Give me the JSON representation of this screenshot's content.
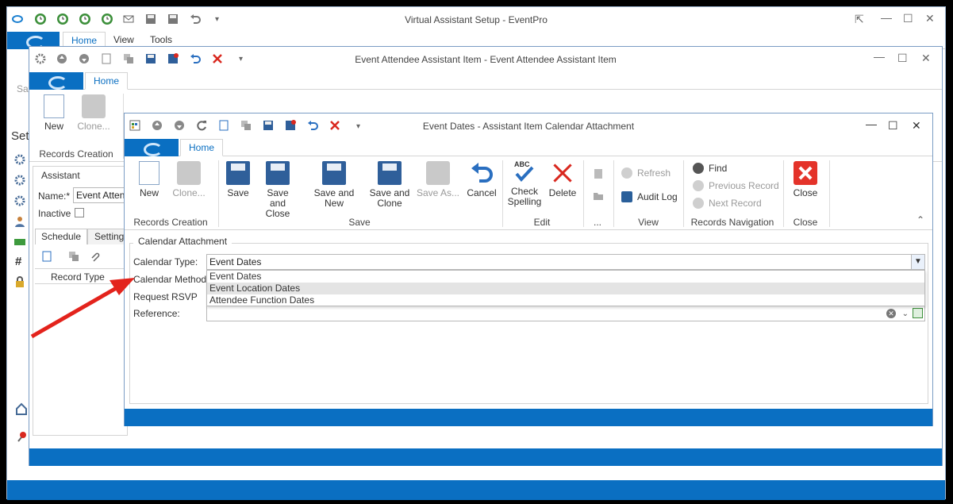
{
  "main_window": {
    "title": "Virtual Assistant Setup - EventPro",
    "tabs": [
      "Home",
      "View",
      "Tools"
    ],
    "partial_save_label": "Sav",
    "partial_setup_label": "Setu"
  },
  "mid_window": {
    "title": "Event Attendee Assistant Item - Event Attendee Assistant Item",
    "tab": "Home",
    "ribbon": {
      "new": "New",
      "clone": "Clone...",
      "records_creation": "Records Creation"
    },
    "assistant_group": "Assistant",
    "name_label": "Name:*",
    "name_value": "Event Attend",
    "inactive_label": "Inactive",
    "subtabs": [
      "Schedule",
      "Settings"
    ],
    "grid_header": "Record Type"
  },
  "dialog": {
    "title": "Event Dates - Assistant Item Calendar Attachment",
    "tab": "Home",
    "ribbon": {
      "new": "New",
      "clone": "Clone...",
      "save": "Save",
      "save_and_close": "Save and Close",
      "save_and_new": "Save and New",
      "save_and_clone": "Save and Clone",
      "save_as": "Save As...",
      "cancel": "Cancel",
      "check_spelling": "Check Spelling",
      "delete": "Delete",
      "refresh": "Refresh",
      "audit_log": "Audit Log",
      "find": "Find",
      "previous_record": "Previous Record",
      "next_record": "Next Record",
      "close": "Close",
      "groups": {
        "records_creation": "Records Creation",
        "save": "Save",
        "edit": "Edit",
        "more": "...",
        "view": "View",
        "records_navigation": "Records Navigation",
        "close": "Close"
      }
    },
    "section_title": "Calendar Attachment",
    "form": {
      "calendar_type_label": "Calendar Type:",
      "calendar_type_value": "Event Dates",
      "calendar_method_label": "Calendar Method:",
      "request_rsvp_label": "Request RSVP",
      "reference_label": "Reference:",
      "dropdown_options": [
        "Event Dates",
        "Event Location Dates",
        "Attendee Function Dates"
      ],
      "highlighted_option": "Event Location Dates"
    }
  },
  "colors": {
    "accent": "#0a6fc2",
    "arrow": "#e3231c",
    "highlight": "#e4e4e4"
  }
}
